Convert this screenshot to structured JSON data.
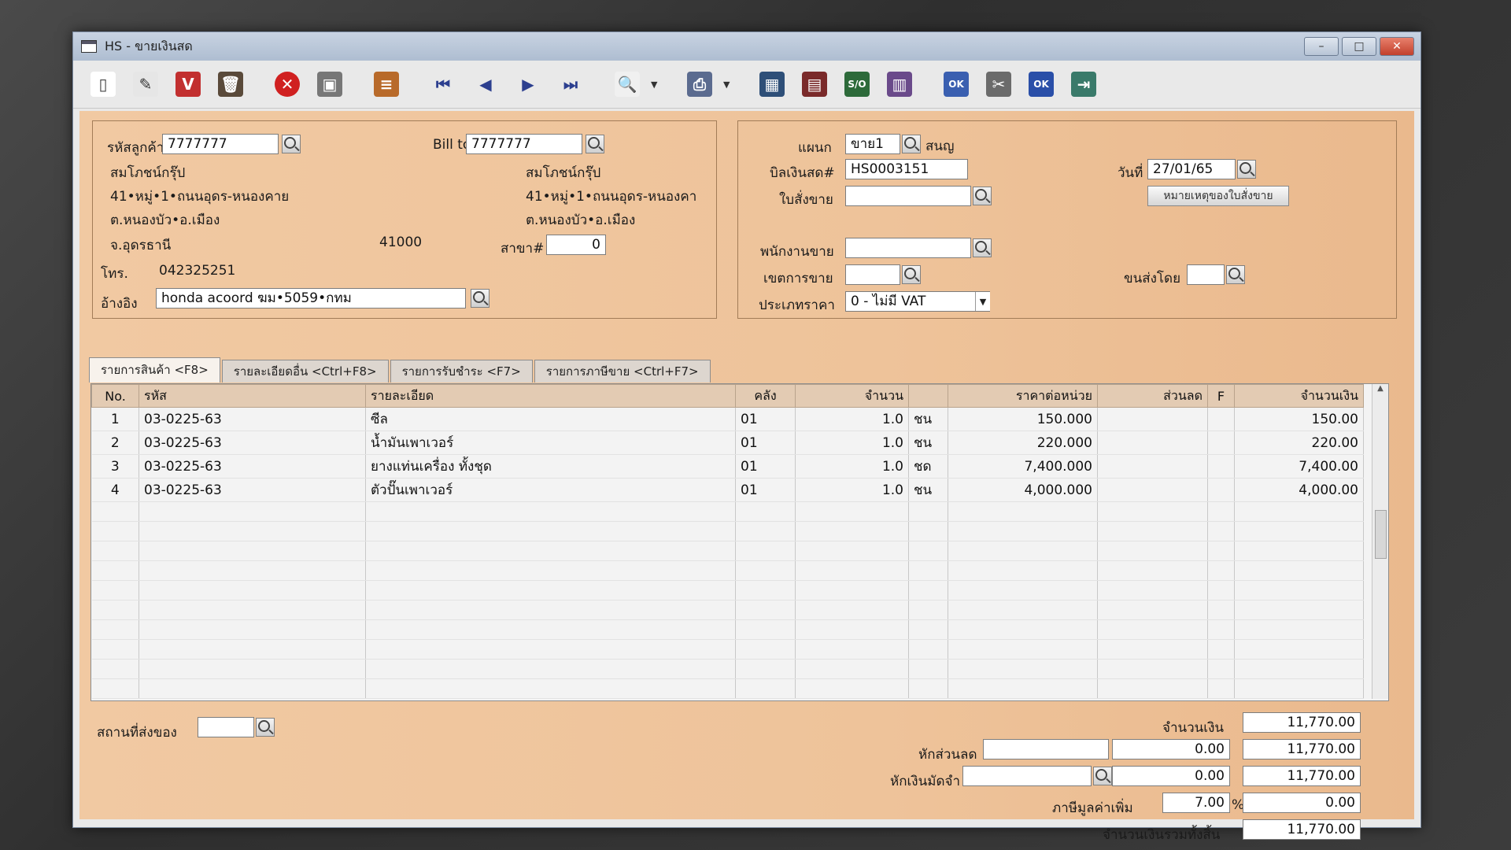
{
  "window": {
    "title": "HS - ขายเงินสด",
    "controls": [
      "–",
      "□",
      "✕"
    ]
  },
  "toolbar": [
    {
      "name": "new-doc-icon",
      "glyph": "▯",
      "color": "#ffffff",
      "fg": "#444"
    },
    {
      "name": "edit-icon",
      "glyph": "✎",
      "color": "#e6e6e6",
      "fg": "#333"
    },
    {
      "name": "void-icon",
      "glyph": "V",
      "color": "#c23030",
      "fg": "#fff"
    },
    {
      "name": "delete-trash-icon",
      "glyph": "🗑",
      "color": "#5a4a3a",
      "fg": "#fff"
    },
    {
      "sep": true
    },
    {
      "name": "cancel-icon",
      "glyph": "✕",
      "color": "#d02020",
      "fg": "#fff",
      "round": true
    },
    {
      "name": "save-icon",
      "glyph": "▣",
      "color": "#777777",
      "fg": "#fff"
    },
    {
      "sep": true
    },
    {
      "name": "books-icon",
      "glyph": "≡",
      "color": "#b86a2a",
      "fg": "#fff"
    },
    {
      "sep": true
    },
    {
      "name": "first-record-icon",
      "glyph": "⏮",
      "color": "#e9e9e9",
      "fg": "#2c3f8f"
    },
    {
      "name": "previous-record-icon",
      "glyph": "◀",
      "color": "#e9e9e9",
      "fg": "#2c3f8f"
    },
    {
      "name": "next-record-icon",
      "glyph": "▶",
      "color": "#e9e9e9",
      "fg": "#2c3f8f"
    },
    {
      "name": "last-record-icon",
      "glyph": "⏭",
      "color": "#e9e9e9",
      "fg": "#2c3f8f"
    },
    {
      "sep": true
    },
    {
      "name": "find-document-icon",
      "glyph": "🔍",
      "color": "#f0f0f0",
      "fg": "#333",
      "drop": true
    },
    {
      "sep": true
    },
    {
      "name": "print-icon",
      "glyph": "⎙",
      "color": "#5b6b8f",
      "fg": "#fff",
      "drop": true
    },
    {
      "sep": true
    },
    {
      "name": "calculator-icon",
      "glyph": "▦",
      "color": "#2e4f78",
      "fg": "#fff"
    },
    {
      "name": "register-icon",
      "glyph": "▤",
      "color": "#7a2a2a",
      "fg": "#fff"
    },
    {
      "name": "ledger-icon",
      "glyph": "S/O",
      "color": "#2d6a3a",
      "fg": "#fff",
      "small": true
    },
    {
      "name": "form-icon",
      "glyph": "▥",
      "color": "#6a4a8a",
      "fg": "#fff"
    },
    {
      "sep": true
    },
    {
      "name": "approve-ok-icon",
      "glyph": "OK",
      "color": "#3a5fb0",
      "fg": "#fff",
      "small": true
    },
    {
      "name": "tools-icon",
      "glyph": "✂",
      "color": "#6b6b6b",
      "fg": "#fff"
    },
    {
      "name": "ok-icon",
      "glyph": "OK",
      "color": "#2a4fa8",
      "fg": "#fff",
      "small": true
    },
    {
      "name": "exit-icon",
      "glyph": "⇥",
      "color": "#3a7a6a",
      "fg": "#fff"
    }
  ],
  "customer": {
    "code_label": "รหัสลูกค้า",
    "code": "7777777",
    "name": "สมโภชน์กรุ๊ป",
    "addr1": "41•หมู่•1•ถนนอุดร-หนองคาย",
    "addr2": "ต.หนองบัว•อ.เมือง",
    "addr3": "จ.อุดรธานี",
    "zip": "41000",
    "phone_label": "โทร.",
    "phone": "042325251",
    "ref_label": "อ้างอิง",
    "ref": "honda acoord ฆม•5059•กทม"
  },
  "bill_to": {
    "label": "Bill to",
    "code": "7777777",
    "name": "สมโภชน์กรุ๊ป",
    "addr1": "41•หมู่•1•ถนนอุดร-หนองคา",
    "addr2": "ต.หนองบัว•อ.เมือง",
    "branch_label": "สาขา#",
    "branch": "0"
  },
  "doc": {
    "dept_label": "แผนก",
    "dept": "ขาย1",
    "dept_name": "สนญ",
    "bill_label": "บิลเงินสด#",
    "bill_no": "HS0003151",
    "order_label": "ใบสั่งขาย",
    "order": "",
    "date_label": "วันที่",
    "date": "27/01/65",
    "note_button": "หมายเหตุของใบสั่งขาย",
    "salesman_label": "พนักงานขาย",
    "salesman": "",
    "area_label": "เขตการขาย",
    "area": "",
    "ship_label": "ขนส่งโดย",
    "ship": "",
    "price_type_label": "ประเภทราคา",
    "price_type": "0 - ไม่มี VAT"
  },
  "tabs": [
    "รายการสินค้า <F8>",
    "รายละเอียดอื่น <Ctrl+F8>",
    "รายการรับชำระ <F7>",
    "รายการภาษีขาย <Ctrl+F7>"
  ],
  "table": {
    "headers": [
      "No.",
      "รหัส",
      "รายละเอียด",
      "คลัง",
      "จำนวน",
      "",
      "ราคาต่อหน่วย",
      "ส่วนลด",
      "F",
      "จำนวนเงิน"
    ],
    "rows": [
      [
        "1",
        "03-0225-63",
        "ซีล",
        "01",
        "1.0",
        "ชน",
        "150.000",
        "",
        "",
        "150.00"
      ],
      [
        "2",
        "03-0225-63",
        "น้ำมันเพาเวอร์",
        "01",
        "1.0",
        "ชน",
        "220.000",
        "",
        "",
        "220.00"
      ],
      [
        "3",
        "03-0225-63",
        "ยางแท่นเครื่อง ทั้งชุด",
        "01",
        "1.0",
        "ชด",
        "7,400.000",
        "",
        "",
        "7,400.00"
      ],
      [
        "4",
        "03-0225-63",
        "ตัวปั๊นเพาเวอร์",
        "01",
        "1.0",
        "ชน",
        "4,000.000",
        "",
        "",
        "4,000.00"
      ]
    ]
  },
  "footer": {
    "delivery_label": "สถานที่ส่งของ",
    "delivery": "",
    "amount_label": "จำนวนเงิน",
    "amount": "11,770.00",
    "discount_label": "หักส่วนลด",
    "discount_text": "",
    "discount": "0.00",
    "after_discount": "11,770.00",
    "deposit_label": "หักเงินมัดจำ",
    "deposit_text": "",
    "deposit": "0.00",
    "after_deposit": "11,770.00",
    "vat_label": "ภาษีมูลค่าเพิ่ม",
    "vat_rate": "7.00",
    "vat_pct": "%",
    "vat_amount": "0.00",
    "total_label": "จำนวนเงินรวมทั้งสิ้น",
    "total": "11,770.00"
  }
}
